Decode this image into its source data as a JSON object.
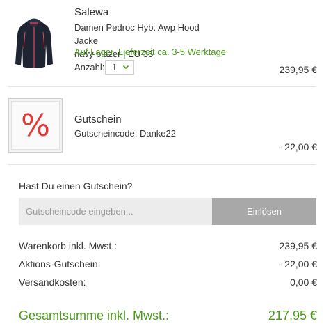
{
  "product": {
    "brand": "Salewa",
    "name_line1": "Damen Pedroc Hyb. Awp Hood Jacke",
    "name_line2": "navy blazer | EU 36",
    "availability": "Auf Lager, Lieferzeit ca. 3-5 Werktage",
    "quantity_label": "Anzahl:",
    "quantity_value": "1",
    "price": "239,95 €",
    "image_icon": "jacket-image"
  },
  "voucher": {
    "symbol": "%",
    "title": "Gutschein",
    "code_text": "Gutscheincode: Danke22",
    "amount": "- 22,00 €"
  },
  "coupon_form": {
    "question": "Hast Du einen Gutschein?",
    "placeholder": "Gutscheincode eingeben...",
    "apply_label": "Einlösen"
  },
  "summary": {
    "rows": [
      {
        "label": "Warenkorb inkl. Mwst.:",
        "value": "239,95 €"
      },
      {
        "label": "Aktions-Gutschein:",
        "value": "- 22,00 €"
      },
      {
        "label": "Versandkosten:",
        "value": "0,00 €"
      }
    ],
    "total_label": "Gesamtsumme inkl. Mwst.:",
    "total_value": "217,95 €"
  },
  "colors": {
    "accent_green": "#4a9a1a",
    "percent_red": "#e53935",
    "button_gray": "#a8a8a8"
  }
}
